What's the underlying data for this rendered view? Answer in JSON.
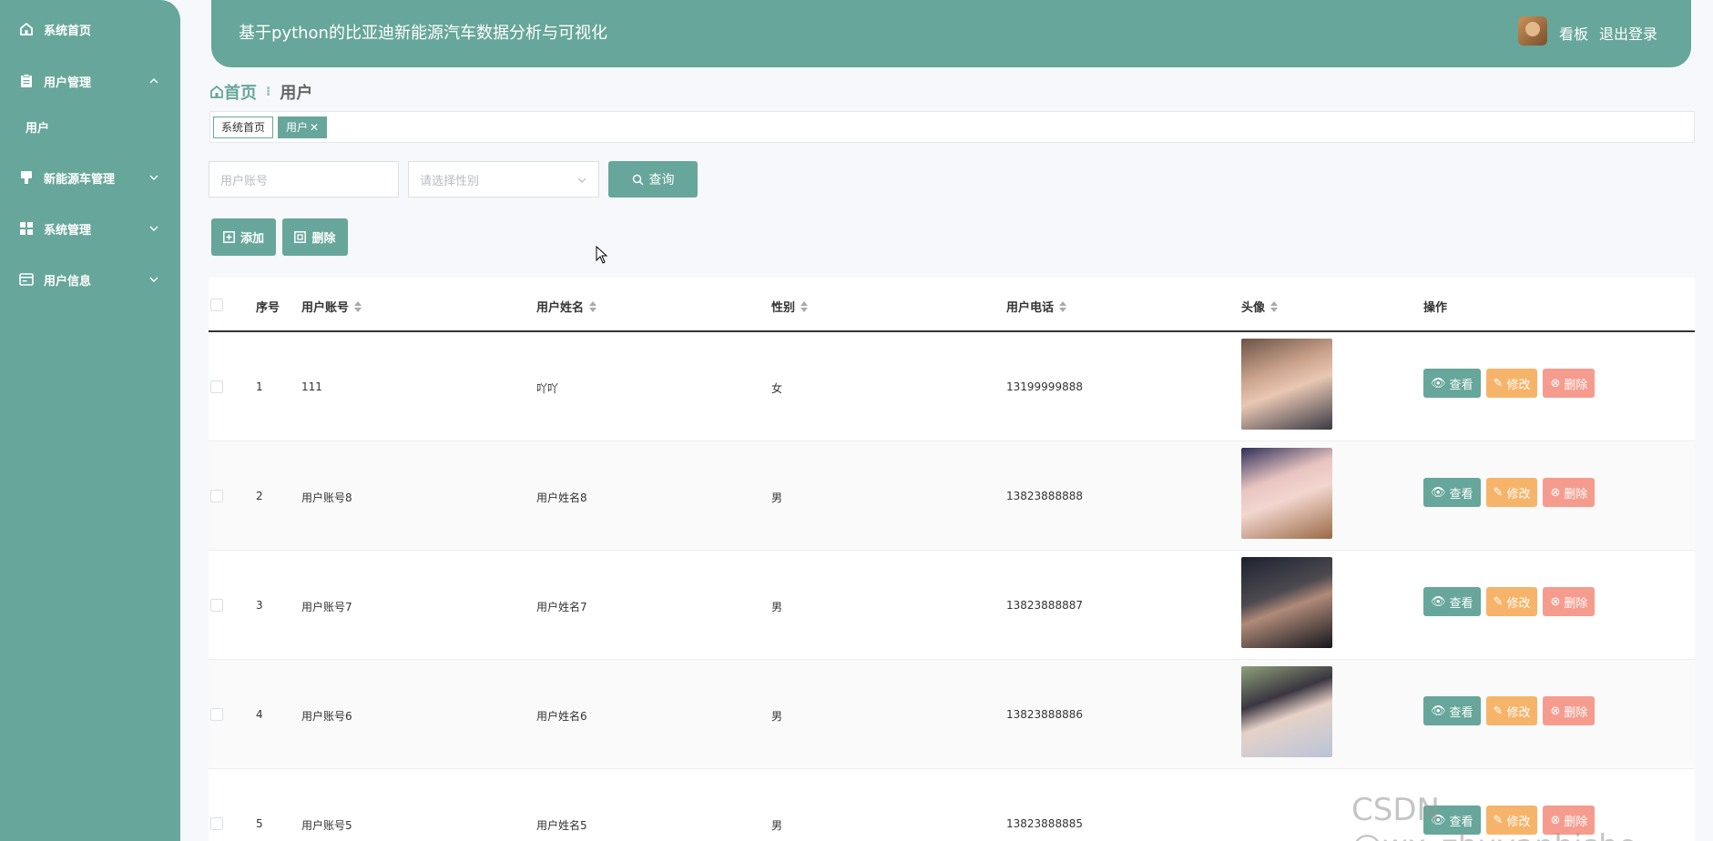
{
  "sidebar": {
    "items": [
      {
        "label": "系统首页",
        "icon": "home-icon"
      },
      {
        "label": "用户管理",
        "icon": "clipboard-icon",
        "expanded": true
      },
      {
        "label": "新能源车管理",
        "icon": "car-icon"
      },
      {
        "label": "系统管理",
        "icon": "grid-icon"
      },
      {
        "label": "用户信息",
        "icon": "id-card-icon"
      }
    ],
    "sub_item": "用户"
  },
  "header": {
    "title": "基于python的比亚迪新能源汽车数据分析与可视化",
    "dashboard_link": "看板",
    "logout_link": "退出登录"
  },
  "breadcrumb": {
    "home": "首页",
    "current": "用户"
  },
  "tags": {
    "home": "系统首页",
    "current": "用户"
  },
  "search": {
    "account_placeholder": "用户账号",
    "gender_placeholder": "请选择性别",
    "query_label": "查询"
  },
  "actions": {
    "add": "添加",
    "delete": "删除"
  },
  "table": {
    "headers": {
      "index": "序号",
      "account": "用户账号",
      "name": "用户姓名",
      "gender": "性别",
      "phone": "用户电话",
      "avatar": "头像",
      "ops": "操作"
    },
    "ops": {
      "view": "查看",
      "edit": "修改",
      "delete": "删除"
    },
    "rows": [
      {
        "index": "1",
        "account": "111",
        "name": "吖吖",
        "gender": "女",
        "phone": "13199999888"
      },
      {
        "index": "2",
        "account": "用户账号8",
        "name": "用户姓名8",
        "gender": "男",
        "phone": "13823888888"
      },
      {
        "index": "3",
        "account": "用户账号7",
        "name": "用户姓名7",
        "gender": "男",
        "phone": "13823888887"
      },
      {
        "index": "4",
        "account": "用户账号6",
        "name": "用户姓名6",
        "gender": "男",
        "phone": "13823888886"
      },
      {
        "index": "5",
        "account": "用户账号5",
        "name": "用户姓名5",
        "gender": "男",
        "phone": "13823888885"
      }
    ]
  },
  "watermark": "CSDN @wx_zhuyanbishe",
  "colors": {
    "primary": "#67a69b",
    "edit": "#f6b46a",
    "delete": "#f59c8e"
  }
}
